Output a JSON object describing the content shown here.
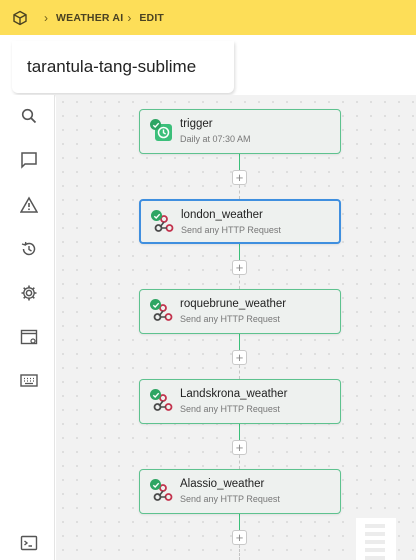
{
  "header": {
    "breadcrumb": [
      "WEATHER AI",
      "EDIT"
    ]
  },
  "page": {
    "title": "tarantula-tang-sublime"
  },
  "sidebar": {
    "items": [
      {
        "icon": "search-icon"
      },
      {
        "icon": "chat-icon"
      },
      {
        "icon": "warning-icon"
      },
      {
        "icon": "history-icon"
      },
      {
        "icon": "gear-icon"
      },
      {
        "icon": "window-settings-icon"
      },
      {
        "icon": "keyboard-icon"
      },
      {
        "icon": "terminal-icon"
      }
    ]
  },
  "flow": {
    "nodes": [
      {
        "name": "trigger",
        "description": "Daily at 07:30 AM",
        "icon": "clock-icon",
        "status": "success",
        "selected": false
      },
      {
        "name": "london_weather",
        "description": "Send any HTTP Request",
        "icon": "webhook-icon",
        "status": "success",
        "selected": true
      },
      {
        "name": "roquebrune_weather",
        "description": "Send any HTTP Request",
        "icon": "webhook-icon",
        "status": "success",
        "selected": false
      },
      {
        "name": "Landskrona_weather",
        "description": "Send any HTTP Request",
        "icon": "webhook-icon",
        "status": "success",
        "selected": false
      },
      {
        "name": "Alassio_weather",
        "description": "Send any HTTP Request",
        "icon": "webhook-icon",
        "status": "success",
        "selected": false
      }
    ],
    "add_step_label": "+"
  },
  "colors": {
    "topbar": "#fdde58",
    "success": "#2ea563",
    "node_border": "#5ec28f",
    "selected_border": "#3f8fdf"
  }
}
